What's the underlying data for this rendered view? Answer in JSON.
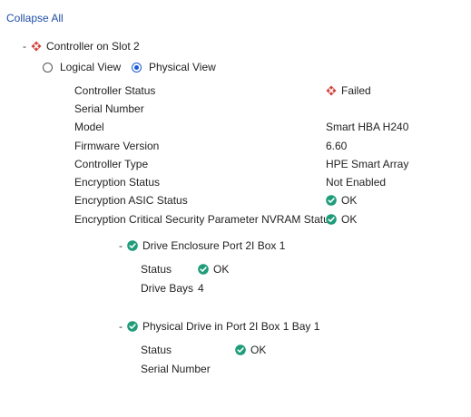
{
  "header": {
    "collapse_all": "Collapse All"
  },
  "controller": {
    "toggle": "-",
    "title": "Controller on Slot 2",
    "views": {
      "logical": "Logical View",
      "physical": "Physical View",
      "selected": "Physical View"
    },
    "properties": [
      {
        "label": "Controller Status",
        "value": "Failed",
        "icon": "failed-diamond-icon"
      },
      {
        "label": "Serial Number",
        "value": ""
      },
      {
        "label": "Model",
        "value": "Smart HBA H240"
      },
      {
        "label": "Firmware Version",
        "value": "6.60"
      },
      {
        "label": "Controller Type",
        "value": "HPE Smart Array"
      },
      {
        "label": "Encryption Status",
        "value": "Not Enabled"
      },
      {
        "label": "Encryption ASIC Status",
        "value": "OK",
        "icon": "ok-check-icon"
      },
      {
        "label": "Encryption Critical Security Parameter NVRAM Status",
        "value": "OK",
        "icon": "ok-check-icon"
      }
    ]
  },
  "enclosure": {
    "toggle": "-",
    "title": "Drive Enclosure Port 2I Box 1",
    "properties": [
      {
        "label": "Status",
        "value": "OK",
        "icon": "ok-check-icon"
      },
      {
        "label": "Drive Bays",
        "value": "4"
      }
    ]
  },
  "physical_drive": {
    "toggle": "-",
    "title": "Physical Drive in Port 2I Box 1 Bay 1",
    "properties": [
      {
        "label": "Status",
        "value": "OK",
        "icon": "ok-check-icon"
      },
      {
        "label": "Serial Number",
        "value": ""
      }
    ]
  },
  "colors": {
    "ok": "#1f9c7a",
    "failed": "#d0413b",
    "link": "#1f4fa6",
    "radio": "#1a5ad7"
  }
}
